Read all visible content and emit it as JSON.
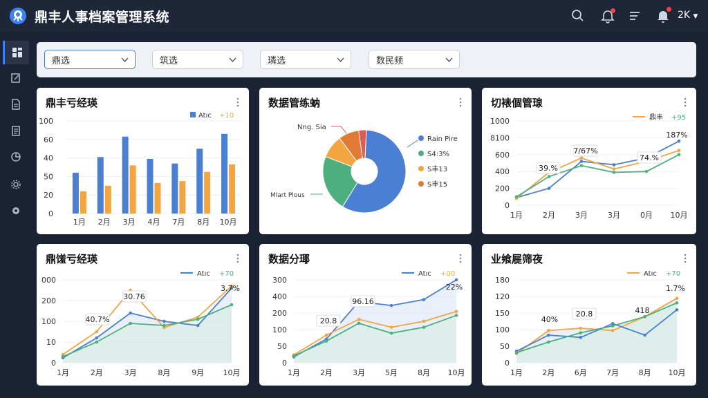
{
  "app": {
    "title": "鼎丰人事档案管理系统",
    "user": "2K"
  },
  "topbar": {
    "icons": [
      "search-icon",
      "bell-icon",
      "menu-lines-icon",
      "bell-icon"
    ]
  },
  "sidebar": {
    "items": [
      "dashboard-icon",
      "edit-icon",
      "document-icon",
      "clipboard-icon",
      "chart-icon",
      "gear-icon",
      "settings-icon"
    ]
  },
  "filters": [
    {
      "label": "鼎选"
    },
    {
      "label": "筑选"
    },
    {
      "label": "璘选"
    },
    {
      "label": "数民频"
    }
  ],
  "colors": {
    "blue": "#4a7fd1",
    "orange": "#f2a541",
    "green": "#4caf7d",
    "red": "#e05a4f",
    "darkorange": "#e07a34"
  },
  "cards": [
    {
      "title": "鼎丰亏经瑛",
      "chart_data": {
        "type": "bar",
        "categories": [
          "1月",
          "2月",
          "3月",
          "4月",
          "7月",
          "8月",
          "10月"
        ],
        "series": [
          {
            "name": "Atıc",
            "values": [
              44,
              61,
              83,
              59,
              54,
              70,
              86
            ]
          },
          {
            "name": "+10",
            "values": [
              24,
              30,
              52,
              33,
              35,
              45,
              53
            ]
          }
        ],
        "yticks": [
          "0",
          "20",
          "50",
          "40",
          "60",
          "100"
        ],
        "ylim": [
          0,
          100
        ]
      }
    },
    {
      "title": "数据管练蚋",
      "chart_data": {
        "type": "pie",
        "slices": [
          {
            "name": "Rain Pire",
            "value": 58
          },
          {
            "name": "S4:3%",
            "value": 22
          },
          {
            "name": "S丰13",
            "value": 9
          },
          {
            "name": "S丰15",
            "value": 8
          },
          {
            "name": "",
            "value": 3
          }
        ],
        "annotations": [
          "Nng. Sia",
          "Mlart Plous"
        ]
      }
    },
    {
      "title": "切裱個管瑔",
      "chart_data": {
        "type": "line",
        "legend": [
          "鼎丰",
          "+95"
        ],
        "categories": [
          "1月",
          "2月",
          "3月",
          "3月",
          "0月",
          "10月"
        ],
        "yticks": [
          "0",
          "200",
          "400",
          "600",
          "8100",
          "1000"
        ],
        "series": [
          {
            "name": "blue",
            "values": [
              90,
              200,
              520,
              480,
              560,
              760
            ]
          },
          {
            "name": "orange",
            "values": [
              80,
              390,
              560,
              430,
              520,
              650
            ]
          },
          {
            "name": "green",
            "values": [
              100,
              340,
              470,
              390,
              400,
              600
            ]
          }
        ],
        "labels": [
          "39.%",
          "7/67%",
          "74.%",
          "187%"
        ]
      }
    },
    {
      "title": "鼎馐亏经瑛",
      "chart_data": {
        "type": "area",
        "legend": [
          "Atıc",
          "+70"
        ],
        "categories": [
          "1月",
          "2月",
          "3月",
          "8月",
          "9月",
          "10月"
        ],
        "yticks": [
          "0",
          "10",
          "100",
          "200",
          "000"
        ],
        "series": [
          {
            "name": "blue",
            "values": [
              12,
              60,
              120,
              100,
              90,
              180
            ]
          },
          {
            "name": "orange",
            "values": [
              20,
              75,
              175,
              85,
              110,
              185
            ]
          },
          {
            "name": "green",
            "values": [
              15,
              50,
              95,
              90,
              105,
              140
            ]
          }
        ],
        "labels": [
          "40.7%",
          "30.76",
          "3.7%"
        ]
      }
    },
    {
      "title": "数据分瑘",
      "chart_data": {
        "type": "area",
        "legend": [
          "Atıc",
          "+00"
        ],
        "categories": [
          "1月",
          "2月",
          "3月",
          "5月",
          "8月",
          "10月"
        ],
        "yticks": [
          "0",
          "50",
          "100",
          "200",
          "400",
          "300"
        ],
        "series": [
          {
            "name": "blue",
            "values": [
              30,
              120,
              310,
              290,
              320,
              420
            ]
          },
          {
            "name": "orange",
            "values": [
              40,
              140,
              220,
              180,
              210,
              260
            ]
          },
          {
            "name": "green",
            "values": [
              35,
              110,
              200,
              150,
              180,
              240
            ]
          }
        ],
        "labels": [
          "20.8",
          "96.16",
          "22%"
        ]
      }
    },
    {
      "title": "业飨屣筛夜",
      "chart_data": {
        "type": "area",
        "legend": [
          "Atıc",
          "+70"
        ],
        "categories": [
          "1月",
          "2月",
          "6月",
          "7月",
          "8月",
          "10月"
        ],
        "yticks": [
          "0",
          "50",
          "100",
          "150",
          "120",
          "180"
        ],
        "series": [
          {
            "name": "orange",
            "values": [
              20,
              70,
              75,
              70,
              100,
              140
            ]
          },
          {
            "name": "blue",
            "values": [
              25,
              60,
              55,
              85,
              60,
              115
            ]
          },
          {
            "name": "green",
            "values": [
              22,
              45,
              65,
              80,
              100,
              130
            ]
          }
        ],
        "labels": [
          "40%",
          "20.8",
          "418",
          "1.7%"
        ]
      }
    }
  ]
}
